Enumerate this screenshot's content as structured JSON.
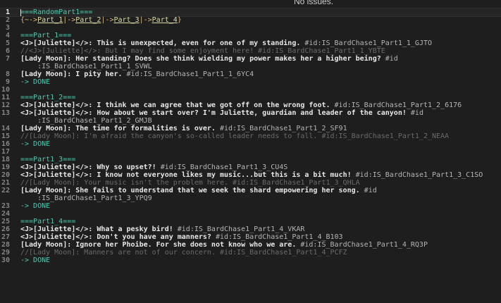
{
  "status_text": "No issues.",
  "lines": [
    {
      "n": "1",
      "current": true,
      "segs": [
        {
          "t": "===RandomPart1===",
          "c": "k"
        }
      ]
    },
    {
      "n": "2",
      "segs": [
        {
          "t": "{~->",
          "c": "y"
        },
        {
          "t": "Part_1",
          "c": "lnk"
        },
        {
          "t": "|->",
          "c": "y"
        },
        {
          "t": "Part_2",
          "c": "lnk"
        },
        {
          "t": "|->",
          "c": "y"
        },
        {
          "t": "Part_3",
          "c": "lnk"
        },
        {
          "t": "|->",
          "c": "y"
        },
        {
          "t": "Part_4",
          "c": "lnk"
        },
        {
          "t": "}",
          "c": "y"
        }
      ]
    },
    {
      "n": "3",
      "segs": []
    },
    {
      "n": "4",
      "segs": [
        {
          "t": "===Part_1===",
          "c": "k"
        }
      ]
    },
    {
      "n": "5",
      "segs": [
        {
          "t": "<J>[Juliette]</>: ",
          "c": "b"
        },
        {
          "t": "This is unexpected, even for one of my standing. ",
          "c": "b"
        },
        {
          "t": "#id:IS_BardChase1_Part1_1_GJTO",
          "c": "id"
        }
      ]
    },
    {
      "n": "6",
      "segs": [
        {
          "t": "//<J>[Juliette]</>: But I may find some enjoyment here! #id:IS_BardChase1_Part1_1_YBTE",
          "c": "c"
        }
      ]
    },
    {
      "n": "7",
      "segs": [
        {
          "t": "[Lady Moon]: Her standing? Does she think wielding my power makes her a higher being? ",
          "c": "b"
        },
        {
          "t": "#id",
          "c": "id"
        }
      ]
    },
    {
      "n": "",
      "segs": [
        {
          "t": "    :IS_BardChase1_Part1_1_SVWL",
          "c": "id"
        }
      ]
    },
    {
      "n": "8",
      "segs": [
        {
          "t": "[Lady Moon]: I pity her. ",
          "c": "b"
        },
        {
          "t": "#id:IS_BardChase1_Part1_1_6YC4",
          "c": "id"
        }
      ]
    },
    {
      "n": "9",
      "segs": [
        {
          "t": "-> DONE",
          "c": "k"
        }
      ]
    },
    {
      "n": "10",
      "segs": []
    },
    {
      "n": "11",
      "segs": [
        {
          "t": "===Part1_2===",
          "c": "k"
        }
      ]
    },
    {
      "n": "12",
      "segs": [
        {
          "t": "<J>[Juliette]</>: ",
          "c": "b"
        },
        {
          "t": "I think we can agree that we got off on the wrong foot. ",
          "c": "b"
        },
        {
          "t": "#id:IS_BardChase1_Part1_2_6176",
          "c": "id"
        }
      ]
    },
    {
      "n": "13",
      "segs": [
        {
          "t": "<J>[Juliette]</>: ",
          "c": "b"
        },
        {
          "t": "How about we start over? I'm Juliette, guardian and leader of the canyon! ",
          "c": "b"
        },
        {
          "t": "#id",
          "c": "id"
        }
      ]
    },
    {
      "n": "",
      "segs": [
        {
          "t": "    :IS_BardChase1_Part1_2_GMJB",
          "c": "id"
        }
      ]
    },
    {
      "n": "14",
      "segs": [
        {
          "t": "[Lady Moon]: The time for formalities is over. ",
          "c": "b"
        },
        {
          "t": "#id:IS_BardChase1_Part1_2_SF91",
          "c": "id"
        }
      ]
    },
    {
      "n": "15",
      "segs": [
        {
          "t": "//[Lady Moon]: I'm afraid the canyon's so-called leader needs to fall. #id:IS_BardChase1_Part1_2_NEAA",
          "c": "c"
        }
      ]
    },
    {
      "n": "16",
      "segs": [
        {
          "t": "-> DONE",
          "c": "k"
        }
      ]
    },
    {
      "n": "17",
      "segs": []
    },
    {
      "n": "18",
      "segs": [
        {
          "t": "===Part1_3===",
          "c": "k"
        }
      ]
    },
    {
      "n": "19",
      "segs": [
        {
          "t": "<J>[Juliette]</>: ",
          "c": "b"
        },
        {
          "t": "Why so upset?! ",
          "c": "b"
        },
        {
          "t": "#id:IS_BardChase1_Part1_3_CU4S",
          "c": "id"
        }
      ]
    },
    {
      "n": "20",
      "segs": [
        {
          "t": "<J>[Juliette]</>: ",
          "c": "b"
        },
        {
          "t": "I know not everyone likes my music...but this is a bit much! ",
          "c": "b"
        },
        {
          "t": "#id:IS_BardChase1_Part1_3_C1SO",
          "c": "id"
        }
      ]
    },
    {
      "n": "21",
      "segs": [
        {
          "t": "//[Lady Moon]: Your music isn't the problem here. #id:IS_BardChase1_Part1_3_QHLA",
          "c": "c"
        }
      ]
    },
    {
      "n": "22",
      "segs": [
        {
          "t": "[Lady Moon]: She fails to understand that we seek the shard empowering her song. ",
          "c": "b"
        },
        {
          "t": "#id",
          "c": "id"
        }
      ]
    },
    {
      "n": "",
      "segs": [
        {
          "t": "    :IS_BardChase1_Part1_3_YPQ9",
          "c": "id"
        }
      ]
    },
    {
      "n": "23",
      "segs": [
        {
          "t": "-> DONE",
          "c": "k"
        }
      ]
    },
    {
      "n": "24",
      "segs": []
    },
    {
      "n": "25",
      "segs": [
        {
          "t": "===Part1_4===",
          "c": "k"
        }
      ]
    },
    {
      "n": "26",
      "segs": [
        {
          "t": "<J>[Juliette]</>: ",
          "c": "b"
        },
        {
          "t": "What a pesky bird! ",
          "c": "b"
        },
        {
          "t": "#id:IS_BardChase1_Part1_4_VKAR",
          "c": "id"
        }
      ]
    },
    {
      "n": "27",
      "segs": [
        {
          "t": "<J>[Juliette]</>: ",
          "c": "b"
        },
        {
          "t": "Don't you have any manners? ",
          "c": "b"
        },
        {
          "t": "#id:IS_BardChase1_Part1_4_B103",
          "c": "id"
        }
      ]
    },
    {
      "n": "28",
      "segs": [
        {
          "t": "[Lady Moon]: Ignore her Phoibe. For she does not know who we are. ",
          "c": "b"
        },
        {
          "t": "#id:IS_BardChase1_Part1_4_RQ3P",
          "c": "id"
        }
      ]
    },
    {
      "n": "29",
      "segs": [
        {
          "t": "//[Lady Moon]: Manners are not of our concern. #id:IS_BardChase1_Part1_4_PCFZ",
          "c": "c"
        }
      ]
    },
    {
      "n": "30",
      "segs": [
        {
          "t": "-> DONE",
          "c": "k"
        }
      ]
    }
  ]
}
